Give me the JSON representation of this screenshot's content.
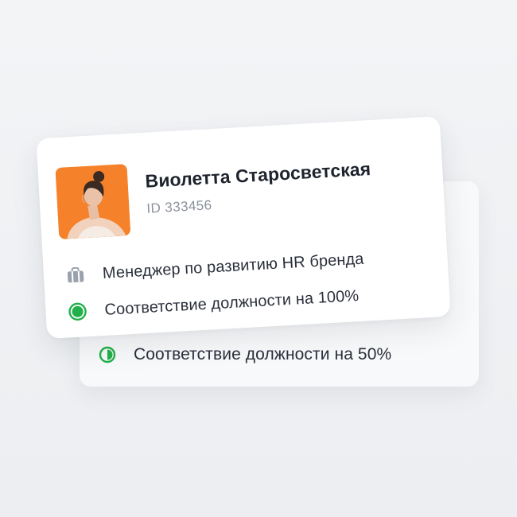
{
  "profile": {
    "name": "Виолетта Старосветская",
    "id_label": "ID 333456",
    "position": "Менеджер по развитию HR бренда",
    "match_front": "Соответствие должности на 100%",
    "match_back": "Соответствие должности на 50%"
  },
  "icons": {
    "position": "briefcase-icon",
    "match_full": "full-circle-icon",
    "match_half": "half-circle-icon"
  },
  "colors": {
    "avatar_bg": "#f5822a",
    "status_green": "#22b04b",
    "icon_gray": "#9aa1ad"
  }
}
